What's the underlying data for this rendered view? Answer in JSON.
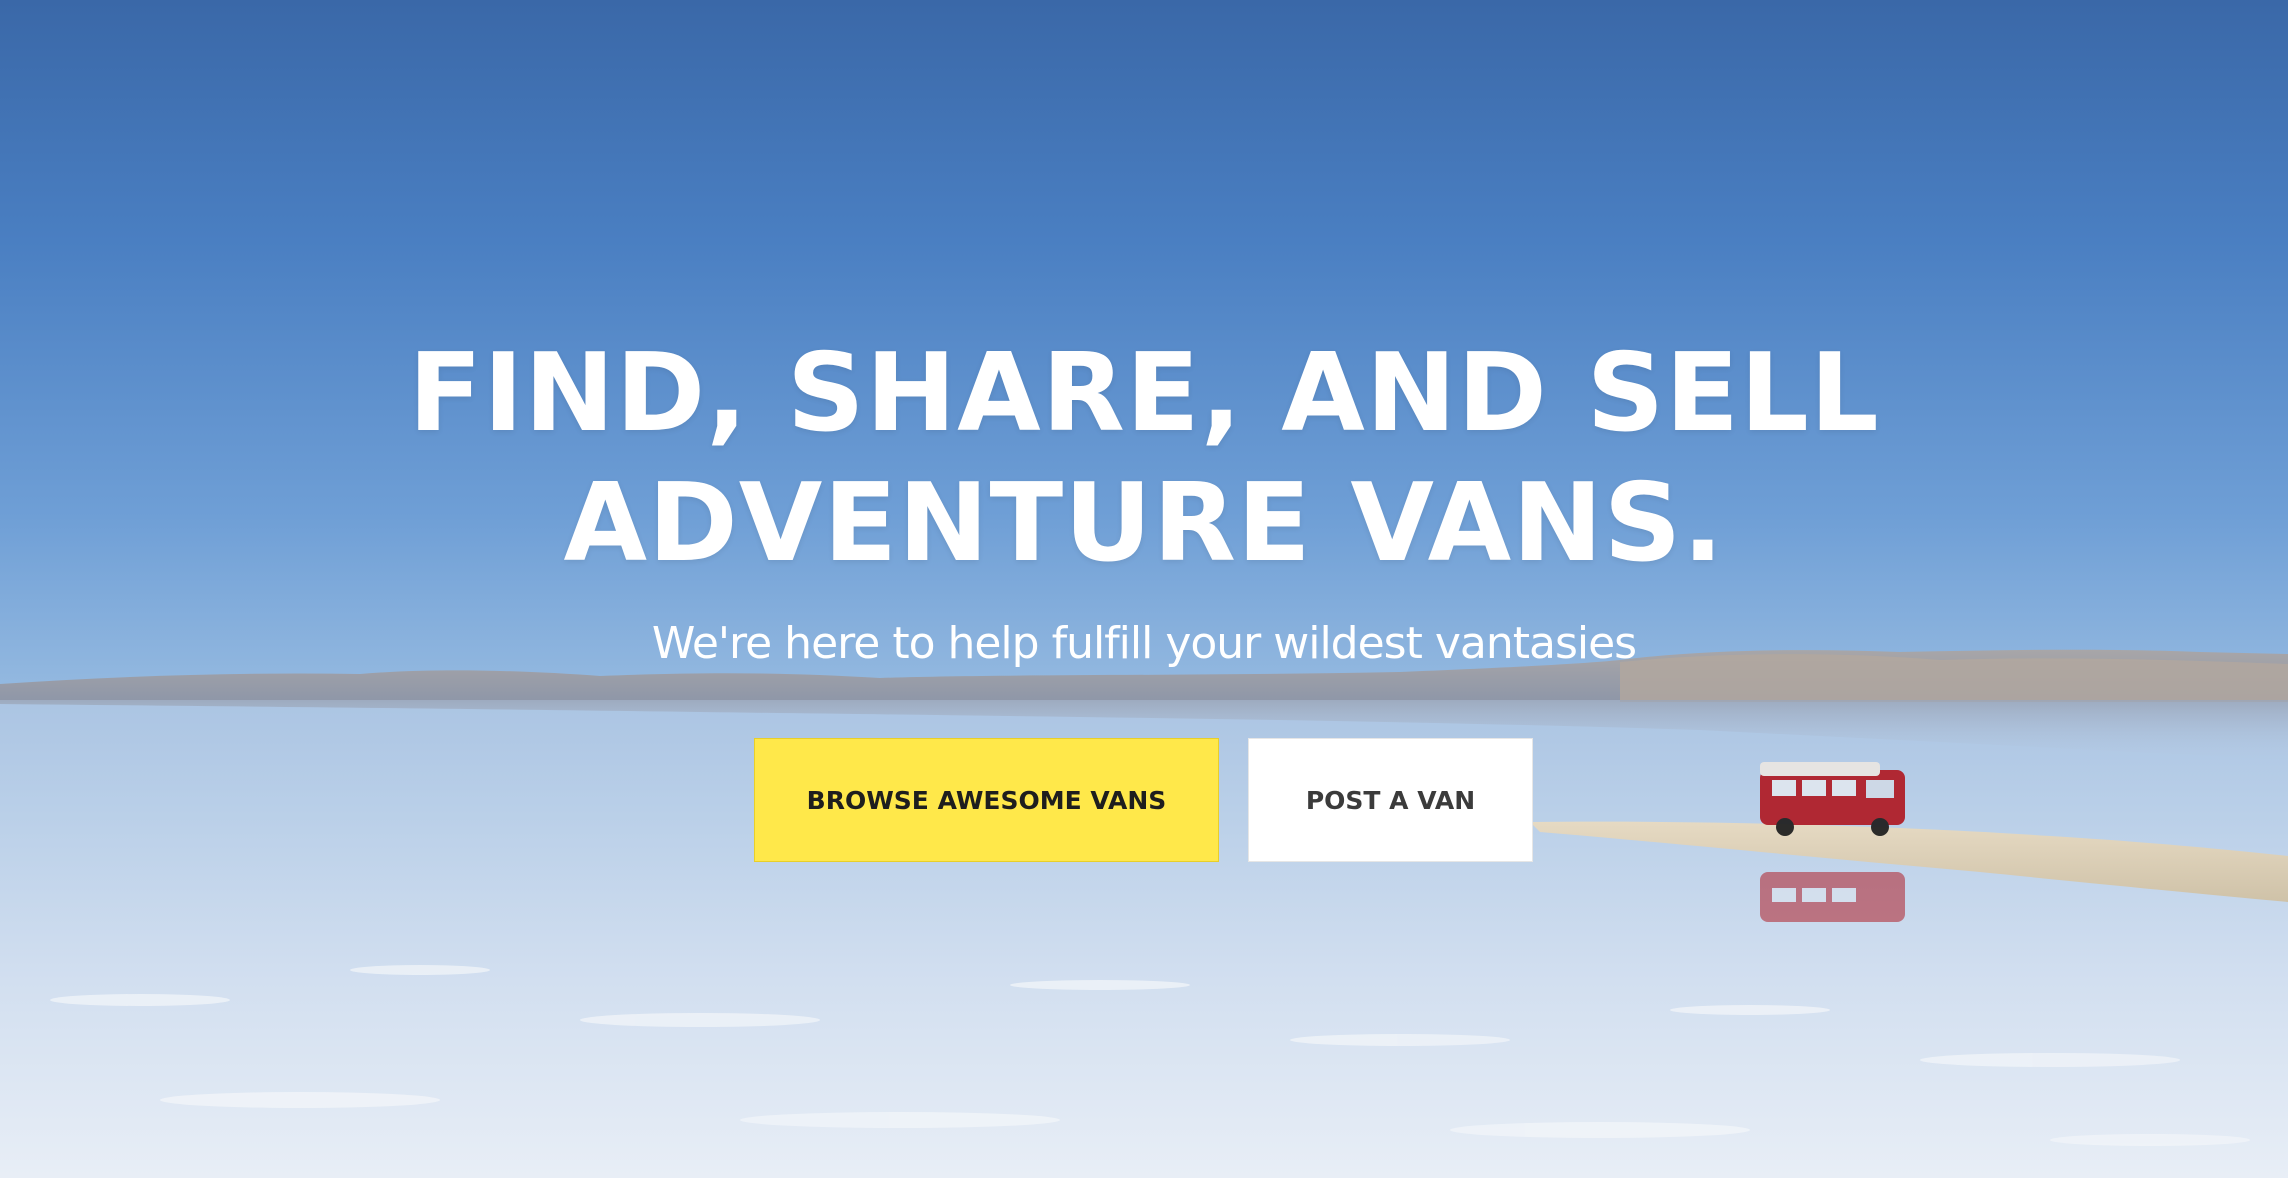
{
  "hero": {
    "headline_line1": "FIND, SHARE, AND SELL",
    "headline_line2": "ADVENTURE VANS.",
    "subtitle": "We're here to help fulfill your wildest vantasies",
    "background_image": "salt-lake-red-van-photo"
  },
  "buttons": {
    "browse_label": "BROWSE AWESOME VANS",
    "post_label": "POST A VAN"
  },
  "colors": {
    "sky_top": "#3a6aaa",
    "sky_horizon": "#8db4df",
    "water": "#b6cde6",
    "salt_flat": "#e4ebf3",
    "van_red": "#b0202a",
    "browse_button_bg": "#ffe84a",
    "post_button_bg": "#ffffff",
    "headline_text": "#ffffff"
  }
}
